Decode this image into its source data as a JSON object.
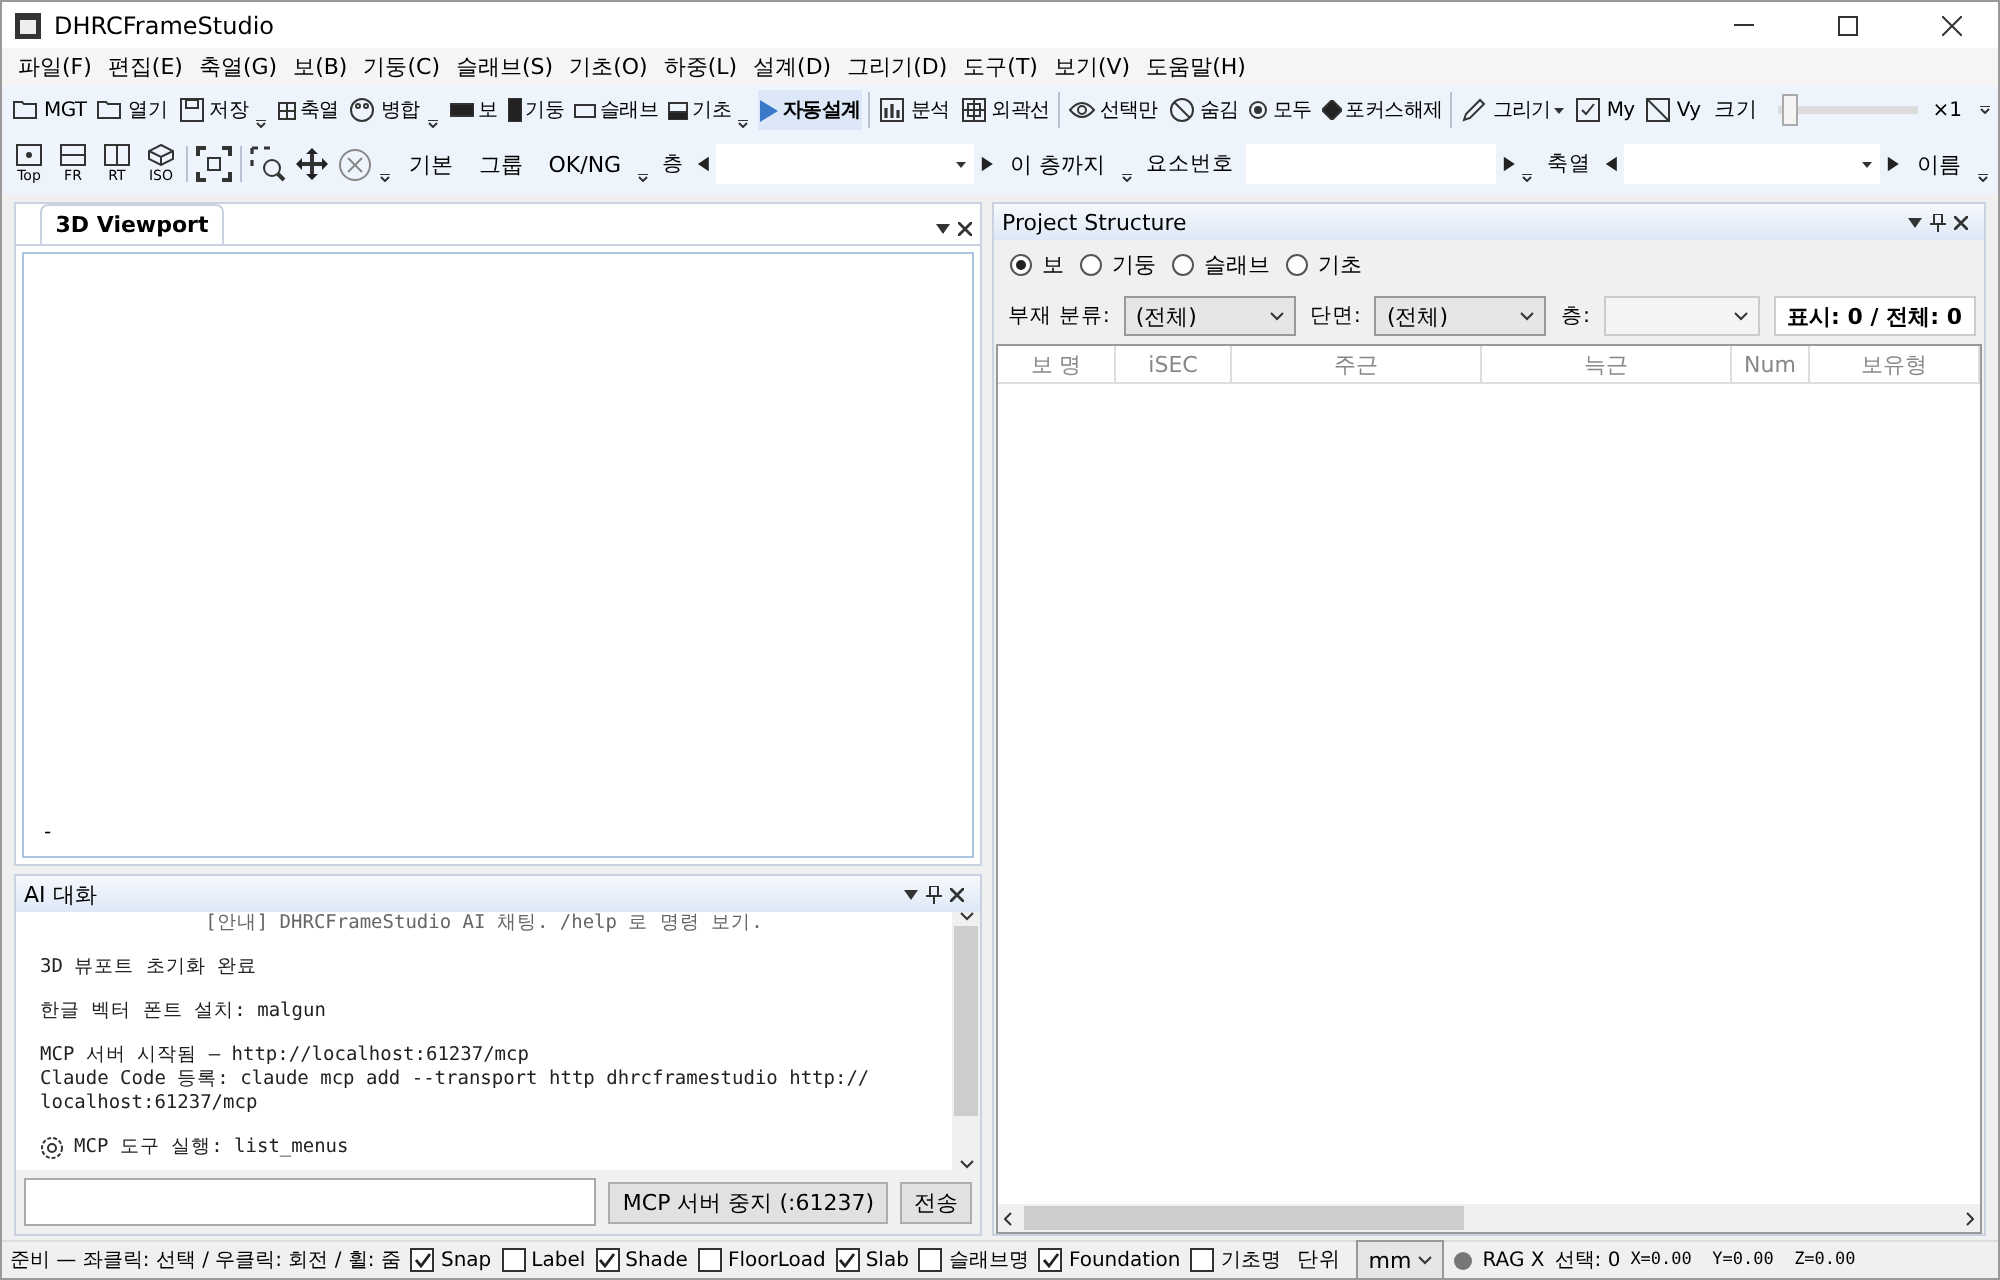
{
  "window": {
    "title": "DHRCFrameStudio"
  },
  "menu": [
    "파일(F)",
    "편집(E)",
    "축열(G)",
    "보(B)",
    "기둥(C)",
    "슬래브(S)",
    "기초(O)",
    "하중(L)",
    "설계(D)",
    "그리기(D)",
    "도구(T)",
    "보기(V)",
    "도움말(H)"
  ],
  "toolbar1": [
    {
      "kind": "button",
      "label": "MGT"
    },
    {
      "kind": "button",
      "label": "열기"
    },
    {
      "kind": "button",
      "label": "저장"
    },
    {
      "kind": "grip"
    },
    {
      "kind": "button",
      "label": "축열"
    },
    {
      "kind": "button",
      "label": "병합"
    },
    {
      "kind": "grip"
    },
    {
      "kind": "button",
      "label": "보"
    },
    {
      "kind": "button",
      "label": "기둥"
    },
    {
      "kind": "button",
      "label": "슬래브"
    },
    {
      "kind": "button",
      "label": "기초"
    },
    {
      "kind": "grip"
    },
    {
      "kind": "primary",
      "label": "자동설계"
    },
    {
      "kind": "sep"
    },
    {
      "kind": "button",
      "label": "분석"
    },
    {
      "kind": "button",
      "label": "외곽선"
    },
    {
      "kind": "sep"
    },
    {
      "kind": "button",
      "label": "선택만"
    },
    {
      "kind": "button",
      "label": "숨김"
    },
    {
      "kind": "button",
      "label": "모두"
    },
    {
      "kind": "button",
      "label": "포커스해제"
    },
    {
      "kind": "sep"
    },
    {
      "kind": "dropdown",
      "label": "그리기"
    },
    {
      "kind": "button",
      "label": "My"
    },
    {
      "kind": "button",
      "label": "Vy"
    },
    {
      "kind": "slider",
      "label": "크기",
      "level": 0.03,
      "reading": "×1"
    }
  ],
  "toolbar2": [
    {
      "kind": "view",
      "label": "Top"
    },
    {
      "kind": "view",
      "label": "FR"
    },
    {
      "kind": "view",
      "label": "RT"
    },
    {
      "kind": "view",
      "label": "ISO"
    },
    {
      "kind": "sep"
    },
    {
      "kind": "icon"
    },
    {
      "kind": "sep"
    },
    {
      "kind": "icon"
    },
    {
      "kind": "icon"
    },
    {
      "kind": "icon"
    },
    {
      "kind": "grip"
    },
    {
      "kind": "text",
      "label": "기본"
    },
    {
      "kind": "text",
      "label": "그룹"
    },
    {
      "kind": "text",
      "label": "OK/NG"
    },
    {
      "kind": "grip"
    },
    {
      "kind": "stepper",
      "label": "층"
    },
    {
      "kind": "text",
      "label": "이 층까지"
    },
    {
      "kind": "grip"
    },
    {
      "kind": "input",
      "label": "요소번호"
    },
    {
      "kind": "grip"
    },
    {
      "kind": "stepper",
      "label": "축열"
    },
    {
      "kind": "text",
      "label": "이름"
    },
    {
      "kind": "grip"
    }
  ],
  "viewport": {
    "tab": "3D Viewport",
    "status": "-"
  },
  "chat": {
    "title": "AI 대화",
    "messages": [
      {
        "kind": "notice",
        "text": "[안내] DHRCFrameStudio AI 채팅. /help 로 명령 보기."
      },
      {
        "kind": "plain",
        "text": "3D 뷰포트 초기화 완료"
      },
      {
        "kind": "plain",
        "text": "한글 벡터 폰트 설치: malgun"
      },
      {
        "kind": "plain",
        "text": "MCP 서버 시작됨 — http://localhost:61237/mcp\nClaude Code 등록: claude mcp add --transport http dhrcframestudio http://\nlocalhost:61237/mcp"
      },
      {
        "kind": "tool",
        "text": "MCP 도구 실행: list_menus"
      }
    ],
    "server_button": "MCP 서버 중지 (:61237)",
    "send_button": "전송"
  },
  "structure": {
    "title": "Project Structure",
    "types": [
      {
        "label": "보",
        "selected": true
      },
      {
        "label": "기둥",
        "selected": false
      },
      {
        "label": "슬래브",
        "selected": false
      },
      {
        "label": "기초",
        "selected": false
      }
    ],
    "filters": [
      {
        "label": "부재 분류:",
        "value": "(전체)",
        "disabled": false
      },
      {
        "label": "단면:",
        "value": "(전체)",
        "disabled": false
      },
      {
        "label": "층:",
        "disabled": true
      }
    ],
    "count": "표시: 0 / 전체: 0",
    "columns": [
      "보 명",
      "iSEC",
      "주근",
      "늑근",
      "Num",
      "보유형"
    ]
  },
  "status_bar": {
    "message": "준비 — 좌클릭: 선택 / 우클릭: 회전 / 휠: 줌",
    "toggles": [
      {
        "label": "Snap",
        "checked": true
      },
      {
        "label": "Label",
        "checked": false
      },
      {
        "label": "Shade",
        "checked": true
      },
      {
        "label": "FloorLoad",
        "checked": false
      },
      {
        "label": "Slab",
        "checked": true
      },
      {
        "label": "슬래브명",
        "checked": false
      },
      {
        "label": "Foundation",
        "checked": true
      },
      {
        "label": "기초명",
        "checked": false
      }
    ],
    "unit_label": "단위",
    "unit": "mm",
    "rag": "RAG X",
    "selection": "선택: 0",
    "coords": "X=0.00  Y=0.00  Z=0.00"
  }
}
